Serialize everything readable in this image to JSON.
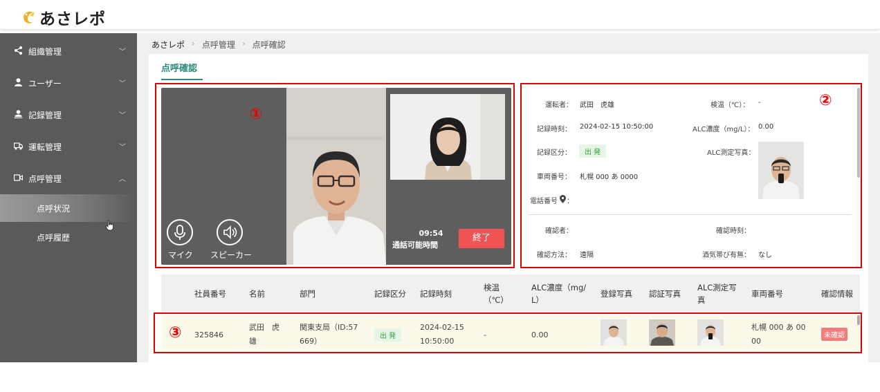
{
  "app": {
    "logo_text": "あさレポ"
  },
  "sidebar": {
    "items": [
      {
        "label": "組織管理",
        "icon": "share-icon",
        "expanded": false
      },
      {
        "label": "ユーザー",
        "icon": "user-icon",
        "expanded": false
      },
      {
        "label": "記録管理",
        "icon": "record-icon",
        "expanded": false
      },
      {
        "label": "運転管理",
        "icon": "truck-icon",
        "expanded": false
      },
      {
        "label": "点呼管理",
        "icon": "video-icon",
        "expanded": true
      }
    ],
    "sub_items": [
      {
        "label": "点呼状況",
        "active": true
      },
      {
        "label": "点呼履歴",
        "active": false
      }
    ]
  },
  "breadcrumb": [
    "あさレポ",
    "点呼管理",
    "点呼確認"
  ],
  "tab": {
    "label": "点呼確認"
  },
  "call": {
    "mic_label": "マイク",
    "speaker_label": "スピーカー",
    "time": "09:54",
    "time_label": "通話可能時間",
    "end_label": "終了"
  },
  "markers": {
    "one": "①",
    "two": "②",
    "three": "③"
  },
  "info": {
    "driver_label": "運転者：",
    "driver_value": "武田　虎雄",
    "temp_label": "検温（℃）：",
    "temp_value": "-",
    "record_time_label": "記録時刻：",
    "record_time_value": "2024-02-15 10:50:00",
    "alc_label": "ALC濃度（mg/L）：",
    "alc_value": "0.00",
    "record_type_label": "記録区分：",
    "record_type_value": "出 発",
    "alc_photo_label": "ALC測定写真：",
    "vehicle_label": "車両番号：",
    "vehicle_value": "札幌 000 あ 0000",
    "phone_label": "電話番号",
    "phone_colon": "：",
    "confirmer_label": "確認者：",
    "confirm_time_label": "確認時刻：",
    "confirm_method_label": "確認方法：",
    "confirm_method_value": "遠隔",
    "alcohol_label": "酒気帯び有無：",
    "alcohol_value": "なし"
  },
  "table": {
    "headers": {
      "employee_no": "社員番号",
      "name": "名前",
      "dept": "部門",
      "record_type": "記録区分",
      "record_time": "記録時刻",
      "temp_1": "検温",
      "temp_2": "（℃）",
      "alc_1": "ALC濃度（mg/",
      "alc_2": "L）",
      "reg_photo": "登録写真",
      "auth_photo": "認証写真",
      "alc_photo_1": "ALC測定写",
      "alc_photo_2": "真",
      "vehicle": "車両番号",
      "confirm": "確認情報"
    },
    "row": {
      "employee_no": "325846",
      "name_1": "武田　虎",
      "name_2": "雄",
      "dept_1": "関東支局（ID:57",
      "dept_2": "669）",
      "record_type": "出 発",
      "time_1": "2024-02-15",
      "time_2": "10:50:00",
      "temp": "-",
      "alc": "0.00",
      "vehicle_1": "札幌 000 あ 00",
      "vehicle_2": "00",
      "status": "未確認"
    }
  },
  "colors": {
    "accent": "#2d8a7a",
    "marker": "#dd0000",
    "end_button": "#f05454",
    "sidebar": "#5a5a5a"
  }
}
